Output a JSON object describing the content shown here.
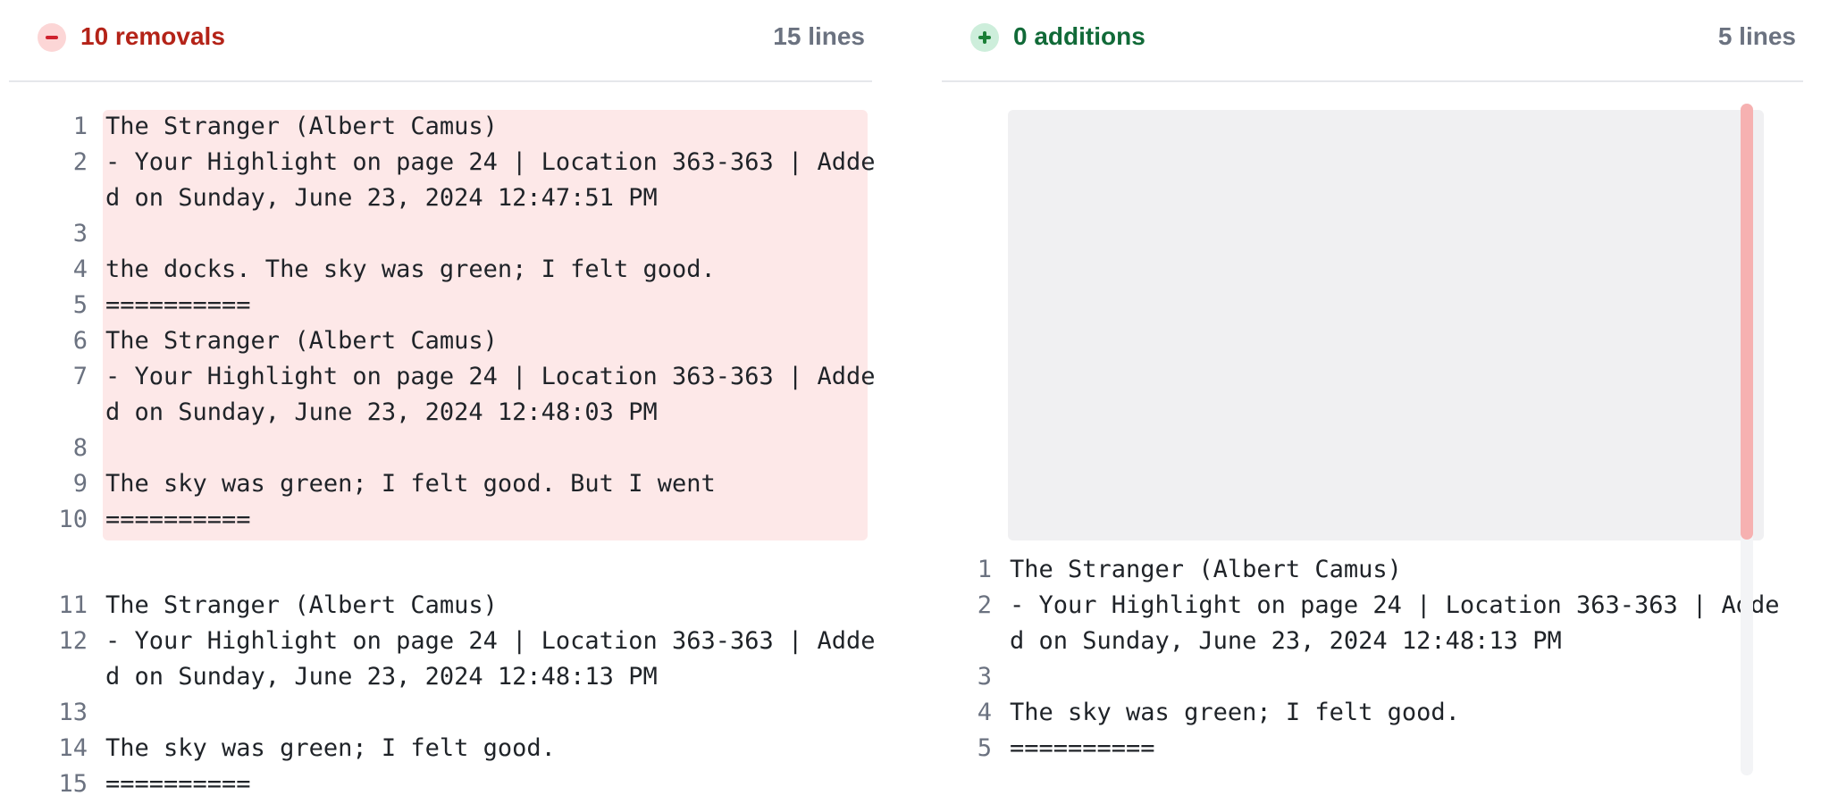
{
  "left": {
    "title": "10 removals",
    "line_count": "15 lines",
    "lines": [
      {
        "n": "1",
        "text": "The Stranger (Albert Camus)"
      },
      {
        "n": "2",
        "text": "- Your Highlight on page 24 | Location 363-363 | Adde"
      },
      {
        "n": "",
        "text": "d on Sunday, June 23, 2024 12:47:51 PM"
      },
      {
        "n": "3",
        "text": ""
      },
      {
        "n": "4",
        "text": "the docks. The sky was green; I felt good."
      },
      {
        "n": "5",
        "text": "=========="
      },
      {
        "n": "6",
        "text": "The Stranger (Albert Camus)"
      },
      {
        "n": "7",
        "text": "- Your Highlight on page 24 | Location 363-363 | Adde"
      },
      {
        "n": "",
        "text": "d on Sunday, June 23, 2024 12:48:03 PM"
      },
      {
        "n": "8",
        "text": ""
      },
      {
        "n": "9",
        "text": "The sky was green; I felt good. But I went"
      },
      {
        "n": "10",
        "text": "=========="
      },
      {
        "n": "11",
        "text": "The Stranger (Albert Camus)"
      },
      {
        "n": "12",
        "text": "- Your Highlight on page 24 | Location 363-363 | Adde"
      },
      {
        "n": "",
        "text": "d on Sunday, June 23, 2024 12:48:13 PM"
      },
      {
        "n": "13",
        "text": ""
      },
      {
        "n": "14",
        "text": "The sky was green; I felt good."
      },
      {
        "n": "15",
        "text": "=========="
      }
    ]
  },
  "right": {
    "title": "0 additions",
    "line_count": "5 lines",
    "lines": [
      {
        "n": "1",
        "text": "The Stranger (Albert Camus)"
      },
      {
        "n": "2",
        "text": "- Your Highlight on page 24 | Location 363-363 | Adde"
      },
      {
        "n": "",
        "text": "d on Sunday, June 23, 2024 12:48:13 PM"
      },
      {
        "n": "3",
        "text": ""
      },
      {
        "n": "4",
        "text": "The sky was green; I felt good."
      },
      {
        "n": "5",
        "text": "=========="
      }
    ]
  },
  "colors": {
    "removed_bg": "#fde8e8",
    "removed_accent": "#cf222e",
    "added_accent": "#1a7f37",
    "placeholder_bg": "#f0f0f2"
  },
  "icons": {
    "removals": "minus-circle-icon",
    "additions": "plus-circle-icon"
  }
}
